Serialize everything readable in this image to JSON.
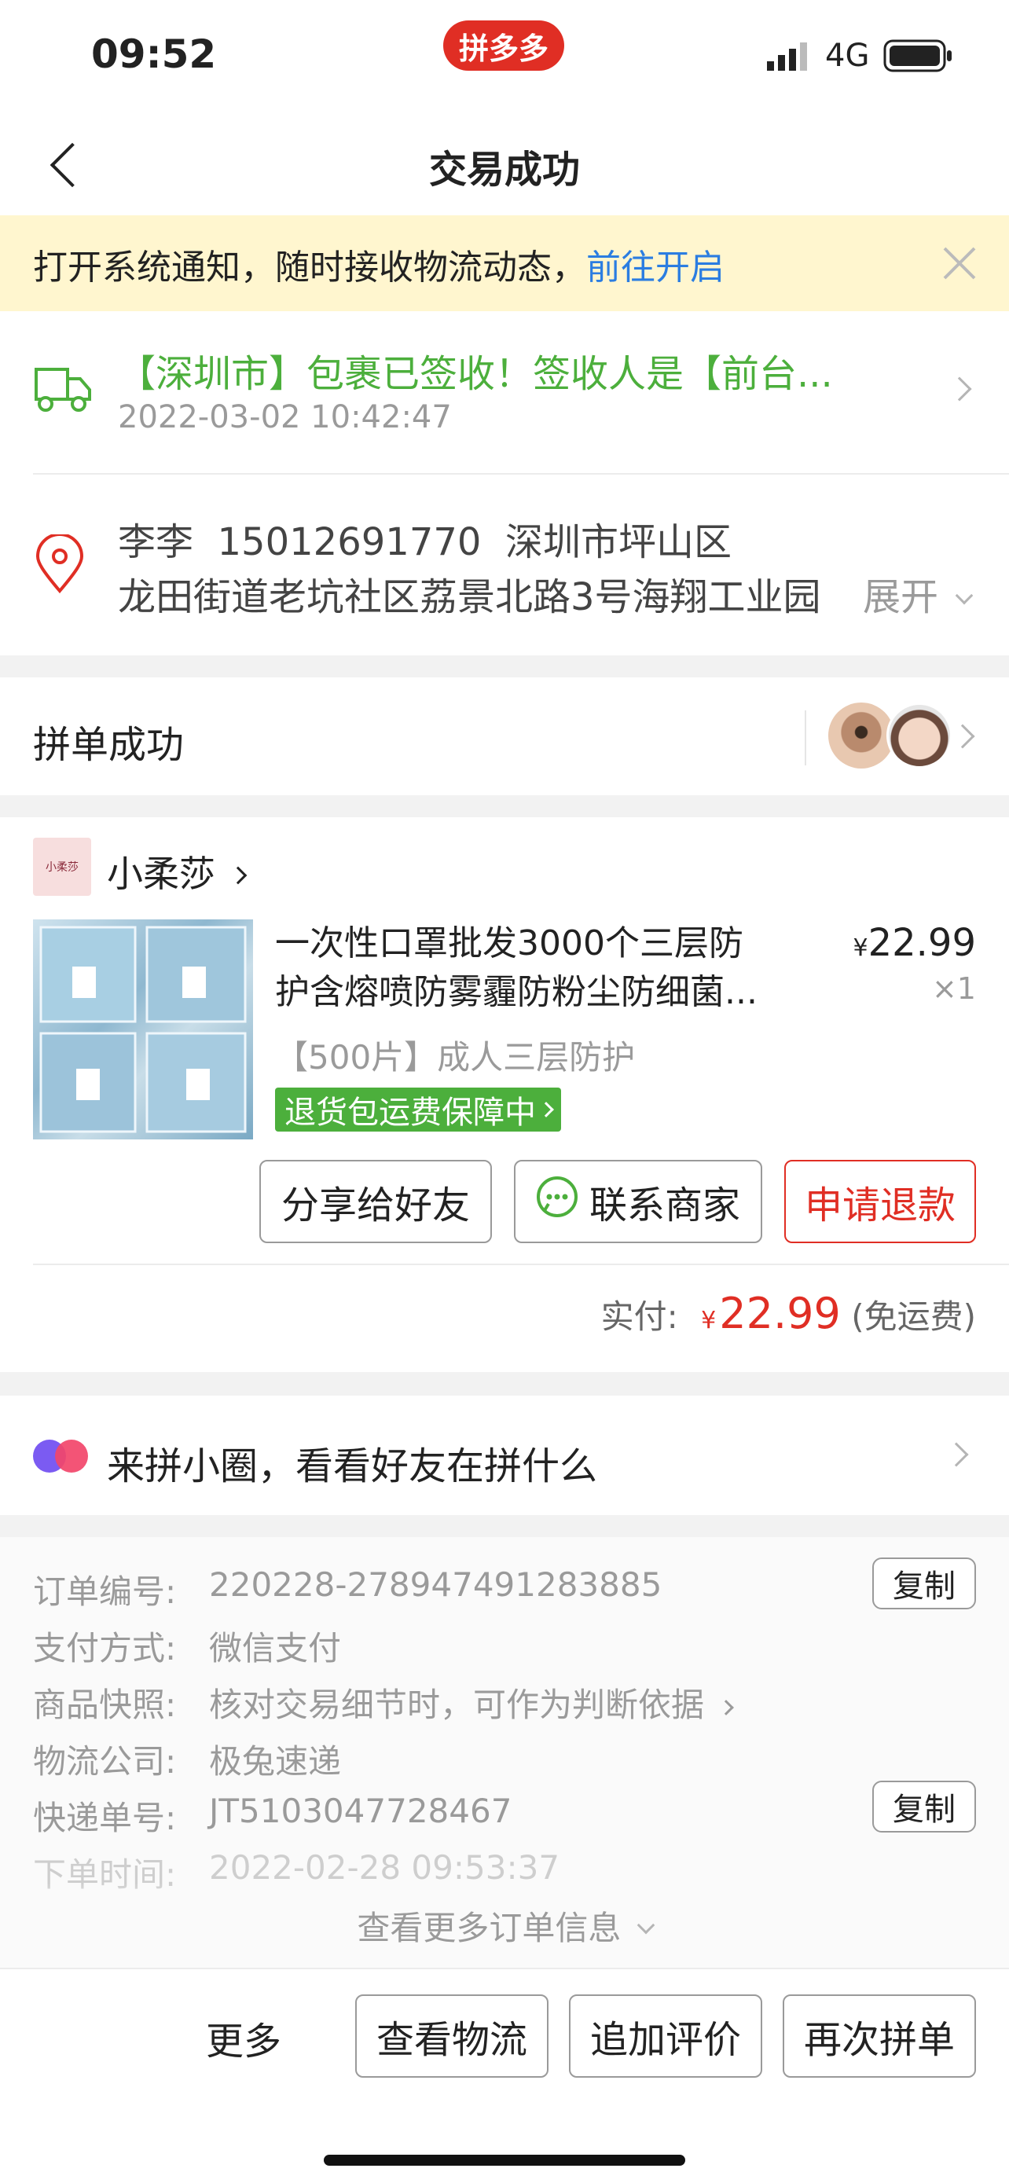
{
  "status_bar": {
    "time": "09:52",
    "app_badge": "拼多多",
    "network": "4G"
  },
  "nav": {
    "title": "交易成功"
  },
  "notice": {
    "text": "打开系统通知，随时接收物流动态，",
    "link": "前往开启"
  },
  "logistics": {
    "status": "【深圳市】包裹已签收！签收人是【前台...",
    "time": "2022-03-02 10:42:47"
  },
  "address": {
    "line1": "李李  15012691770  深圳市坪山区",
    "line2": "龙田街道老坑社区荔景北路3号海翔工业园",
    "expand": "展开"
  },
  "group": {
    "label": "拼单成功"
  },
  "shop": {
    "logo_text": "小柔莎",
    "name": "小柔莎"
  },
  "product": {
    "title_line1": "一次性口罩批发3000个三层防",
    "title_line2": "护含熔喷防雾霾防粉尘防细菌...",
    "currency": "¥",
    "price": "22.99",
    "qty": "×1",
    "spec": "【500片】成人三层防护",
    "guarantee": "退货包运费保障中"
  },
  "actions": {
    "share": "分享给好友",
    "contact": "联系商家",
    "refund": "申请退款"
  },
  "payment": {
    "label": "实付:",
    "currency": "¥",
    "amount": "22.99",
    "note": "(免运费)"
  },
  "circle": {
    "text": "来拼小圈，看看好友在拼什么"
  },
  "order_info": {
    "order_no_label": "订单编号:",
    "order_no": "220228-278947491283885",
    "pay_label": "支付方式:",
    "pay": "微信支付",
    "snapshot_label": "商品快照:",
    "snapshot": "核对交易细节时，可作为判断依据",
    "courier_label": "物流公司:",
    "courier": "极兔速递",
    "tracking_label": "快递单号:",
    "tracking": "JT5103047728467",
    "time_label": "下单时间:",
    "time": "2022-02-28 09:53:37",
    "copy": "复制",
    "more": "查看更多订单信息"
  },
  "bottom": {
    "more": "更多",
    "logistics": "查看物流",
    "review": "追加评价",
    "reorder": "再次拼单"
  },
  "colors": {
    "brand_red": "#e02e24",
    "green": "#4caf3c",
    "link_blue": "#2b7de1",
    "notice_bg": "#fff6cf"
  }
}
